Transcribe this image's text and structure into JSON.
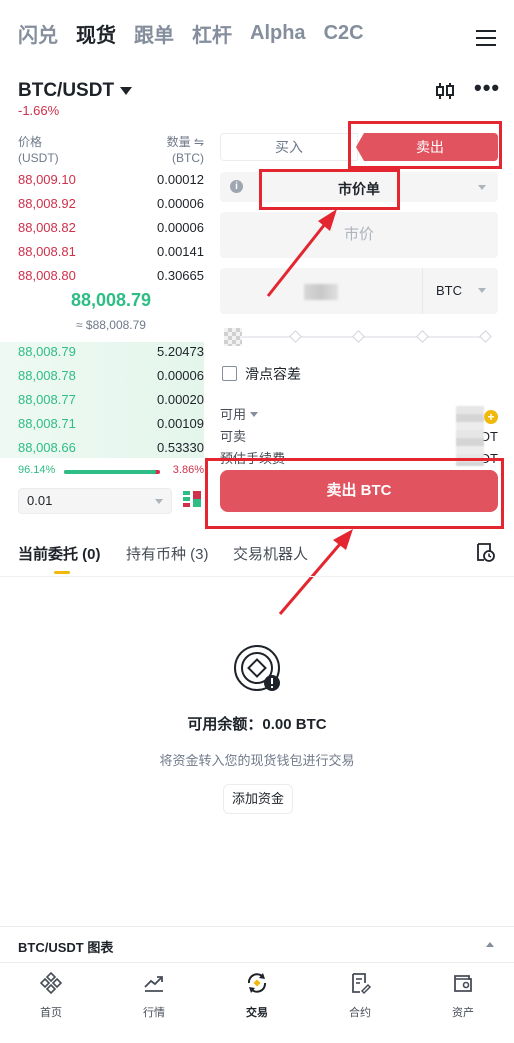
{
  "topnav": {
    "tabs": [
      {
        "label": "闪兑"
      },
      {
        "label": "现货"
      },
      {
        "label": "跟单"
      },
      {
        "label": "杠杆"
      },
      {
        "label": "Alpha"
      },
      {
        "label": "C2C"
      }
    ],
    "active_index": 1
  },
  "pair": {
    "symbol": "BTC/USDT",
    "change": "-1.66%"
  },
  "orderbook": {
    "price_header": "价格",
    "price_unit": "(USDT)",
    "qty_header": "数量 ⇋",
    "qty_unit": "(BTC)",
    "asks": [
      {
        "price": "88,009.10",
        "qty": "0.00012"
      },
      {
        "price": "88,008.92",
        "qty": "0.00006"
      },
      {
        "price": "88,008.82",
        "qty": "0.00006"
      },
      {
        "price": "88,008.81",
        "qty": "0.00141"
      },
      {
        "price": "88,008.80",
        "qty": "0.30665"
      }
    ],
    "last_price": "88,008.79",
    "last_fiat": "≈ $88,008.79",
    "bids": [
      {
        "price": "88,008.79",
        "qty": "5.20473"
      },
      {
        "price": "88,008.78",
        "qty": "0.00006"
      },
      {
        "price": "88,008.77",
        "qty": "0.00020"
      },
      {
        "price": "88,008.71",
        "qty": "0.00109"
      },
      {
        "price": "88,008.66",
        "qty": "0.53330"
      }
    ],
    "buy_ratio": "96.14%",
    "sell_ratio": "3.86%",
    "buy_ratio_value": 0.9614,
    "precision": "0.01"
  },
  "form": {
    "buy_label": "买入",
    "sell_label": "卖出",
    "order_type": "市价单",
    "price_placeholder": "市价",
    "amount_unit": "BTC",
    "slippage_label": "滑点容差",
    "available_label": "可用",
    "sellable_label": "可卖",
    "fee_label": "预估手续费",
    "submit_label": "卖出 BTC"
  },
  "tabs": {
    "open_orders": "当前委托 (0)",
    "holdings": "持有币种 (3)",
    "bots": "交易机器人"
  },
  "empty": {
    "balance": "可用余额：0.00 BTC",
    "hint": "将资金转入您的现货钱包进行交易",
    "add_funds": "添加资金"
  },
  "chartbar": {
    "label": "BTC/USDT 图表"
  },
  "bottomnav": {
    "items": [
      {
        "label": "首页",
        "icon": "home-icon"
      },
      {
        "label": "行情",
        "icon": "markets-icon"
      },
      {
        "label": "交易",
        "icon": "trade-icon"
      },
      {
        "label": "合约",
        "icon": "futures-icon"
      },
      {
        "label": "资产",
        "icon": "wallet-icon"
      }
    ],
    "active_index": 2
  },
  "colors": {
    "sell": "#e0535f",
    "ask": "#cf304a",
    "bid": "#2ebd85",
    "annotation": "#e3262f",
    "accent": "#f0b90b"
  }
}
